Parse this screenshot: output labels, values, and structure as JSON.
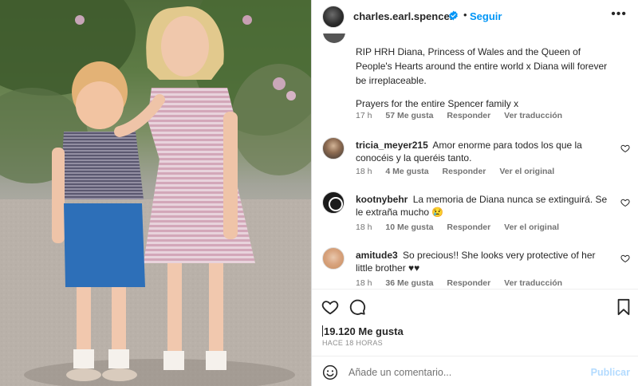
{
  "post": {
    "image_alt": "Vintage photo of a young boy and girl standing outdoors",
    "username": "charles.earl.spencer",
    "verified": true,
    "separator": "•",
    "follow_label": "Seguir",
    "more_icon": "more-options-icon"
  },
  "caption": {
    "paragraph1": "RIP HRH Diana, Princess of Wales and the Queen of People's Hearts around the entire world x Diana will forever be irreplaceable.",
    "paragraph2": "Prayers for the entire Spencer family x",
    "time": "17 h",
    "likes": "57 Me gusta",
    "reply": "Responder",
    "translate": "Ver traducción"
  },
  "comments": [
    {
      "username": "tricia_meyer215",
      "text": "Amor enorme para todos los que la conocéis y la queréis tanto.",
      "time": "18 h",
      "likes": "4 Me gusta",
      "reply": "Responder",
      "action": "Ver el original"
    },
    {
      "username": "kootnybehr",
      "text": "La memoria de Diana nunca se extinguirá. Se le extraña mucho 😢",
      "time": "18 h",
      "likes": "10 Me gusta",
      "reply": "Responder",
      "action": "Ver el original"
    },
    {
      "username": "amitude3",
      "text": "So precious!! She looks very protective of her little brother ♥♥",
      "time": "18 h",
      "likes": "36 Me gusta",
      "reply": "Responder",
      "action": "Ver traducción"
    }
  ],
  "actions": {
    "like_icon": "heart-icon",
    "comment_icon": "comment-icon",
    "save_icon": "bookmark-icon"
  },
  "stats": {
    "likes": "19.120 Me gusta",
    "time_ago": "HACE 18 HORAS"
  },
  "composer": {
    "emoji_icon": "emoji-icon",
    "placeholder": "Añade un comentario...",
    "publish_label": "Publicar"
  },
  "colors": {
    "accent": "#0095f6",
    "publish_disabled": "#b3dbff",
    "muted": "#737373",
    "text": "#262626"
  }
}
